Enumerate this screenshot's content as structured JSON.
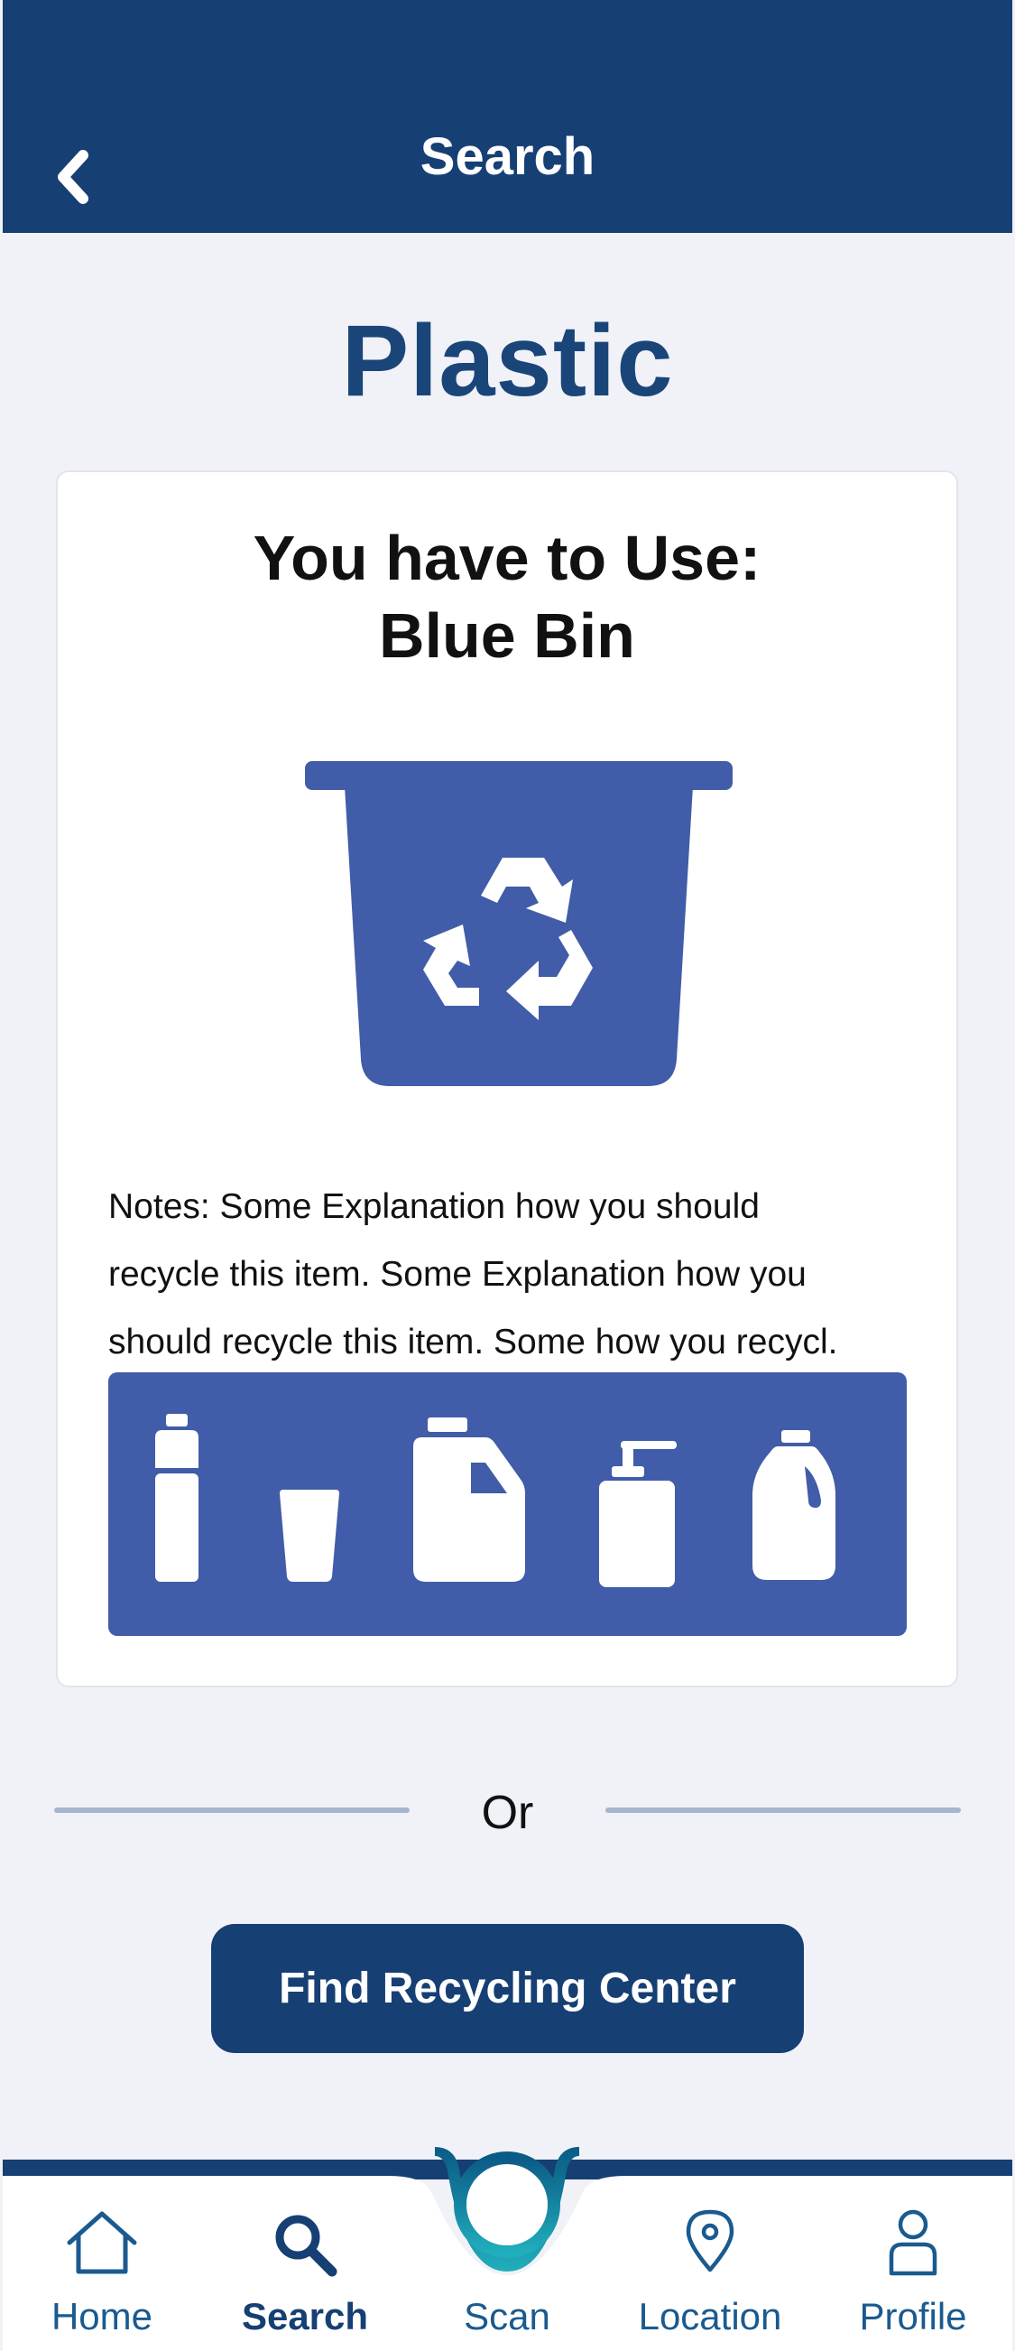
{
  "header": {
    "title": "Search"
  },
  "page": {
    "title": "Plastic"
  },
  "card": {
    "heading_line1": "You have to Use:",
    "heading_line2": "Blue Bin",
    "notes_line1": "Notes: Some Explanation how you should",
    "notes_line2": "recycle this item. Some Explanation how you",
    "notes_line3": "should recycle this item. Some how you  recycl.",
    "bin_icon": "recycling-bin-icon",
    "items": [
      {
        "icon": "water-bottle-icon"
      },
      {
        "icon": "cup-icon"
      },
      {
        "icon": "jerry-can-icon"
      },
      {
        "icon": "pump-bottle-icon"
      },
      {
        "icon": "milk-jug-icon"
      }
    ]
  },
  "divider": {
    "text": "Or"
  },
  "actions": {
    "find_center_label": "Find Recycling Center"
  },
  "nav": {
    "items": [
      {
        "label": "Home",
        "icon": "home-icon",
        "active": false
      },
      {
        "label": "Search",
        "icon": "search-icon",
        "active": true
      },
      {
        "label": "Scan",
        "icon": "scan-icon",
        "active": false
      },
      {
        "label": "Location",
        "icon": "location-pin-icon",
        "active": false
      },
      {
        "label": "Profile",
        "icon": "profile-icon",
        "active": false
      }
    ]
  },
  "colors": {
    "primary": "#163f74",
    "bin_blue": "#415ca8",
    "background": "#f0f2f7",
    "accent_teal": "#1a93a8",
    "nav_text": "#1a5a8f"
  }
}
